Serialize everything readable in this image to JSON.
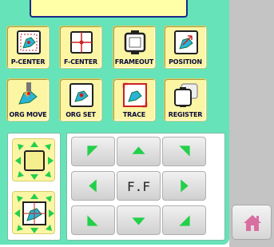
{
  "function_buttons": [
    {
      "label": "P-CENTER",
      "icon": "p-center-icon"
    },
    {
      "label": "F-CENTER",
      "icon": "f-center-icon"
    },
    {
      "label": "FRAMEOUT",
      "icon": "frame-out-icon"
    },
    {
      "label": "POSITION",
      "icon": "position-icon"
    },
    {
      "label": "ORG MOVE",
      "icon": "origin-move-icon"
    },
    {
      "label": "ORG SET",
      "icon": "origin-set-icon"
    },
    {
      "label": "TRACE",
      "icon": "trace-icon"
    },
    {
      "label": "REGISTER",
      "icon": "register-icon"
    }
  ],
  "frame_buttons": [
    {
      "icon": "frame-expand-icon"
    },
    {
      "icon": "pattern-expand-icon"
    }
  ],
  "nav": {
    "center_label": "F.F",
    "arrows": [
      "up-left",
      "up",
      "up-right",
      "left",
      "right",
      "down-left",
      "down",
      "down-right"
    ]
  },
  "home": {
    "icon": "home-icon"
  },
  "colors": {
    "panel": "#66e3b8",
    "button_face": "#fbf5a4",
    "arrow_green": "#22d04a",
    "strip": "#c4c4c4",
    "home_icon": "#d96fa0"
  }
}
